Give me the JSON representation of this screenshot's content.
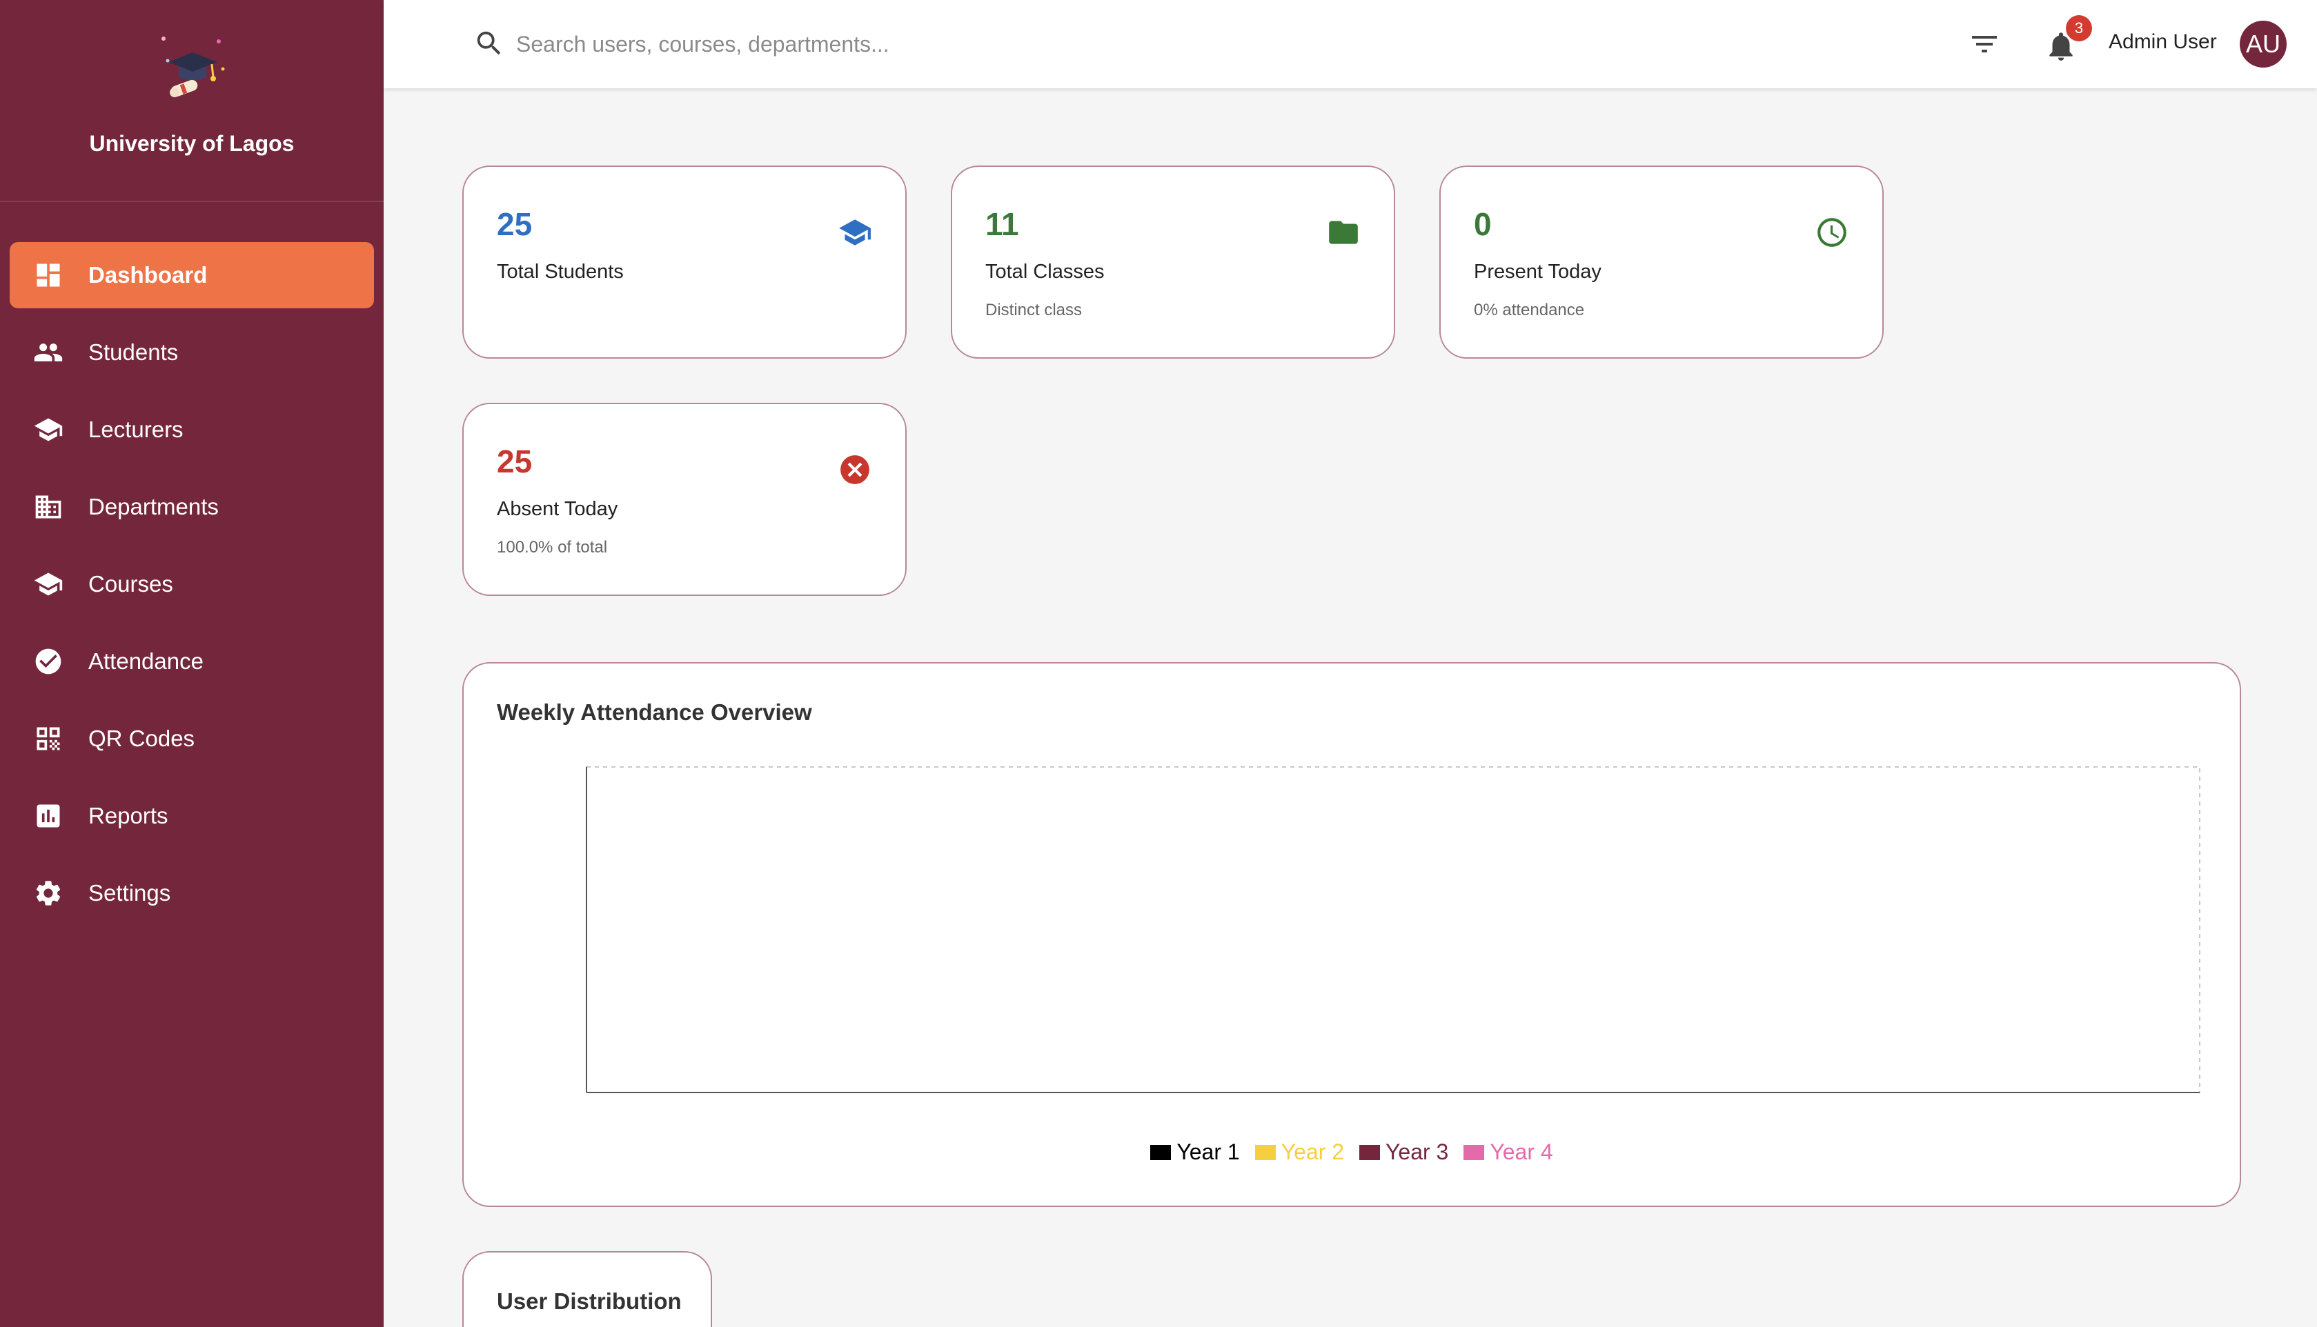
{
  "sidebar": {
    "brand_name": "University of Lagos",
    "items": [
      {
        "label": "Dashboard",
        "icon": "dashboard-icon",
        "active": true
      },
      {
        "label": "Students",
        "icon": "people-icon"
      },
      {
        "label": "Lecturers",
        "icon": "school-icon"
      },
      {
        "label": "Departments",
        "icon": "building-icon"
      },
      {
        "label": "Courses",
        "icon": "school-icon"
      },
      {
        "label": "Attendance",
        "icon": "check-circle-icon"
      },
      {
        "label": "QR Codes",
        "icon": "qr-code-icon"
      },
      {
        "label": "Reports",
        "icon": "bar-chart-icon"
      },
      {
        "label": "Settings",
        "icon": "gear-icon"
      }
    ]
  },
  "topbar": {
    "search_placeholder": "Search users, courses, departments...",
    "notification_count": "3",
    "user_name": "Admin User",
    "avatar_initials": "AU"
  },
  "stats": [
    {
      "value": "25",
      "label": "Total Students",
      "sub": "",
      "color": "#2f6fc2",
      "icon": "school-icon"
    },
    {
      "value": "11",
      "label": "Total Classes",
      "sub": "Distinct class",
      "color": "#3b7a36",
      "icon": "folder-icon"
    },
    {
      "value": "0",
      "label": "Present Today",
      "sub": "0% attendance",
      "color": "#3b7a36",
      "icon": "clock-icon"
    },
    {
      "value": "25",
      "label": "Absent Today",
      "sub": "100.0% of total",
      "color": "#c8372d",
      "icon": "cancel-icon"
    }
  ],
  "weekly_chart": {
    "title": "Weekly Attendance Overview"
  },
  "chart_data": {
    "type": "bar",
    "title": "Weekly Attendance Overview",
    "categories": [],
    "series": [
      {
        "name": "Year 1",
        "color": "#000000",
        "values": []
      },
      {
        "name": "Year 2",
        "color": "#f5cf3f",
        "values": []
      },
      {
        "name": "Year 3",
        "color": "#74263c",
        "values": []
      },
      {
        "name": "Year 4",
        "color": "#e56aa9",
        "values": []
      }
    ],
    "legend": "bottom",
    "grid": false
  },
  "distribution": {
    "title": "User Distribution"
  }
}
